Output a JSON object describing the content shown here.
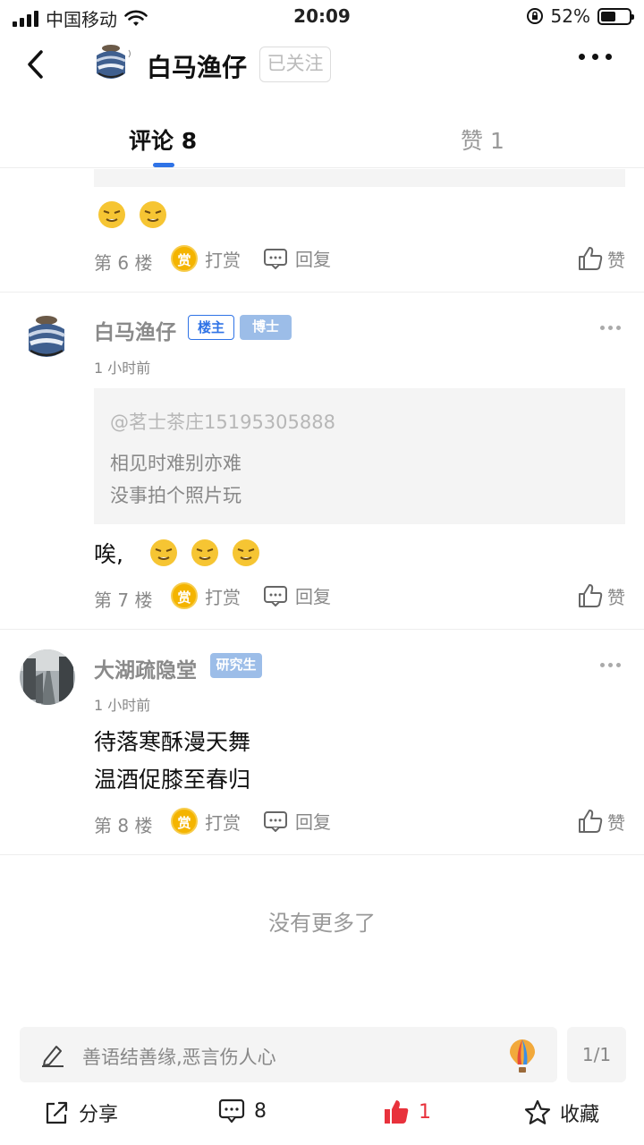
{
  "status_bar": {
    "carrier": "中国移动",
    "time": "20:09",
    "battery": "52%",
    "battery_level": 0.52
  },
  "header": {
    "user_name": "白马渔仔",
    "follow_status": "已关注"
  },
  "tabs": [
    {
      "label": "评论 8",
      "active": true
    },
    {
      "label": "赞 1",
      "active": false
    }
  ],
  "comments": [
    {
      "floor": "第 6 楼",
      "reward": "打赏",
      "reply": "回复",
      "like": "赞",
      "emoji_count": 2
    },
    {
      "user": "白马渔仔",
      "host_badge": "楼主",
      "title_badge": "博士",
      "time": "1 小时前",
      "quote": {
        "at": "@茗士茶庄15195305888",
        "lines": [
          "相见时难别亦难",
          "没事拍个照片玩"
        ]
      },
      "text": "唉,",
      "emoji_count": 3,
      "floor": "第 7 楼",
      "reward": "打赏",
      "reply": "回复",
      "like": "赞"
    },
    {
      "user": "大湖疏隐堂",
      "title_badge": "研究生",
      "time": "1 小时前",
      "lines": [
        "待落寒酥漫天舞",
        "温酒促膝至春归"
      ],
      "floor": "第 8 楼",
      "reward": "打赏",
      "reply": "回复",
      "like": "赞"
    }
  ],
  "reward_coin": "赏",
  "no_more": "没有更多了",
  "input": {
    "placeholder": "善语结善缘,恶言伤人心",
    "page": "1/1"
  },
  "actions": {
    "share": "分享",
    "comments": "8",
    "likes": "1",
    "favorite": "收藏"
  },
  "colors": {
    "accent": "#2f73e6",
    "like_red": "#e8323c",
    "badge_title": "#9cbde8"
  }
}
